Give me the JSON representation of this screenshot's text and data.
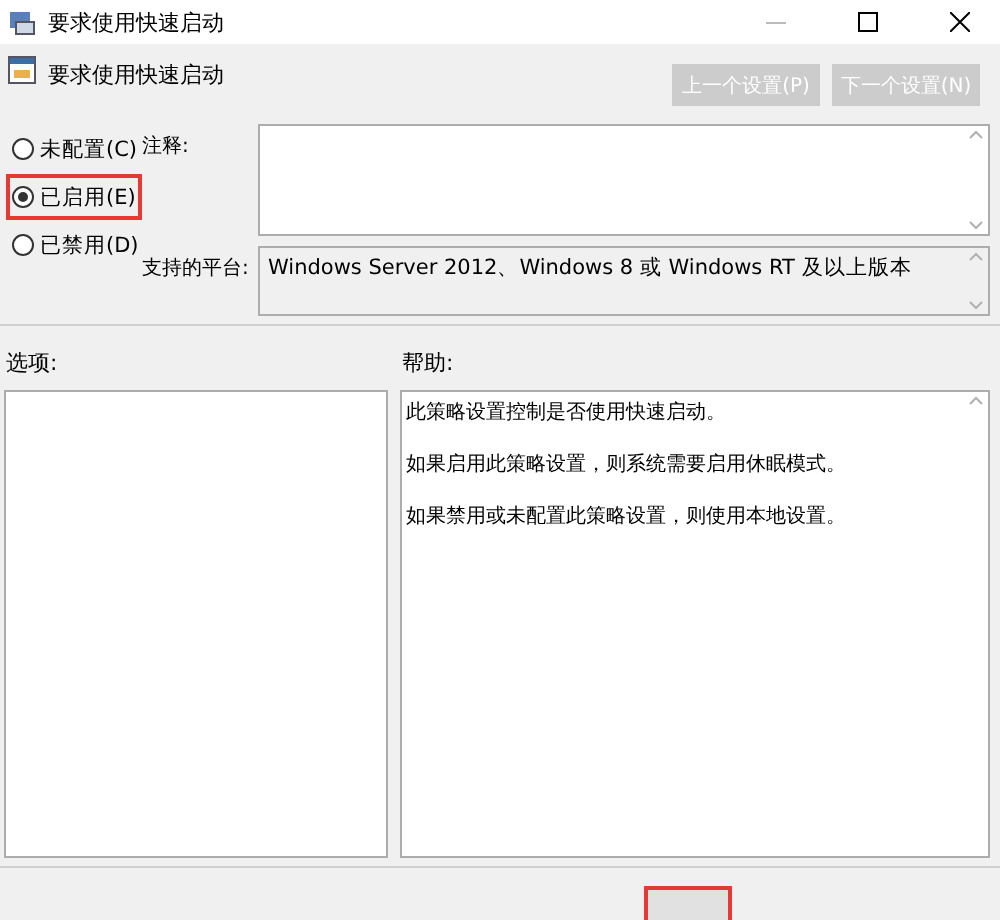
{
  "window": {
    "title": "要求使用快速启动"
  },
  "header": {
    "policy_name": "要求使用快速启动",
    "buttons": [
      {
        "label": "上一个设置(P)",
        "disabled": true
      },
      {
        "label": "下一个设置(N)",
        "disabled": true
      }
    ]
  },
  "state_options": [
    {
      "label": "未配置(C)",
      "selected": false,
      "highlighted": false
    },
    {
      "label": "已启用(E)",
      "selected": true,
      "highlighted": true
    },
    {
      "label": "已禁用(D)",
      "selected": false,
      "highlighted": false
    }
  ],
  "comment": {
    "label": "注释:"
  },
  "supported_on": {
    "label": "支持的平台:",
    "value": "Windows Server 2012、Windows 8 或 Windows RT 及以上版本"
  },
  "options": {
    "label": "选项:"
  },
  "help": {
    "label": "帮助:",
    "paragraphs": [
      "此策略设置控制是否使用快速启动。",
      "如果启用此策略设置，则系统需要启用休眠模式。",
      "如果禁用或未配置此策略设置，则使用本地设置。"
    ]
  },
  "footer_button": {
    "highlighted": true
  }
}
